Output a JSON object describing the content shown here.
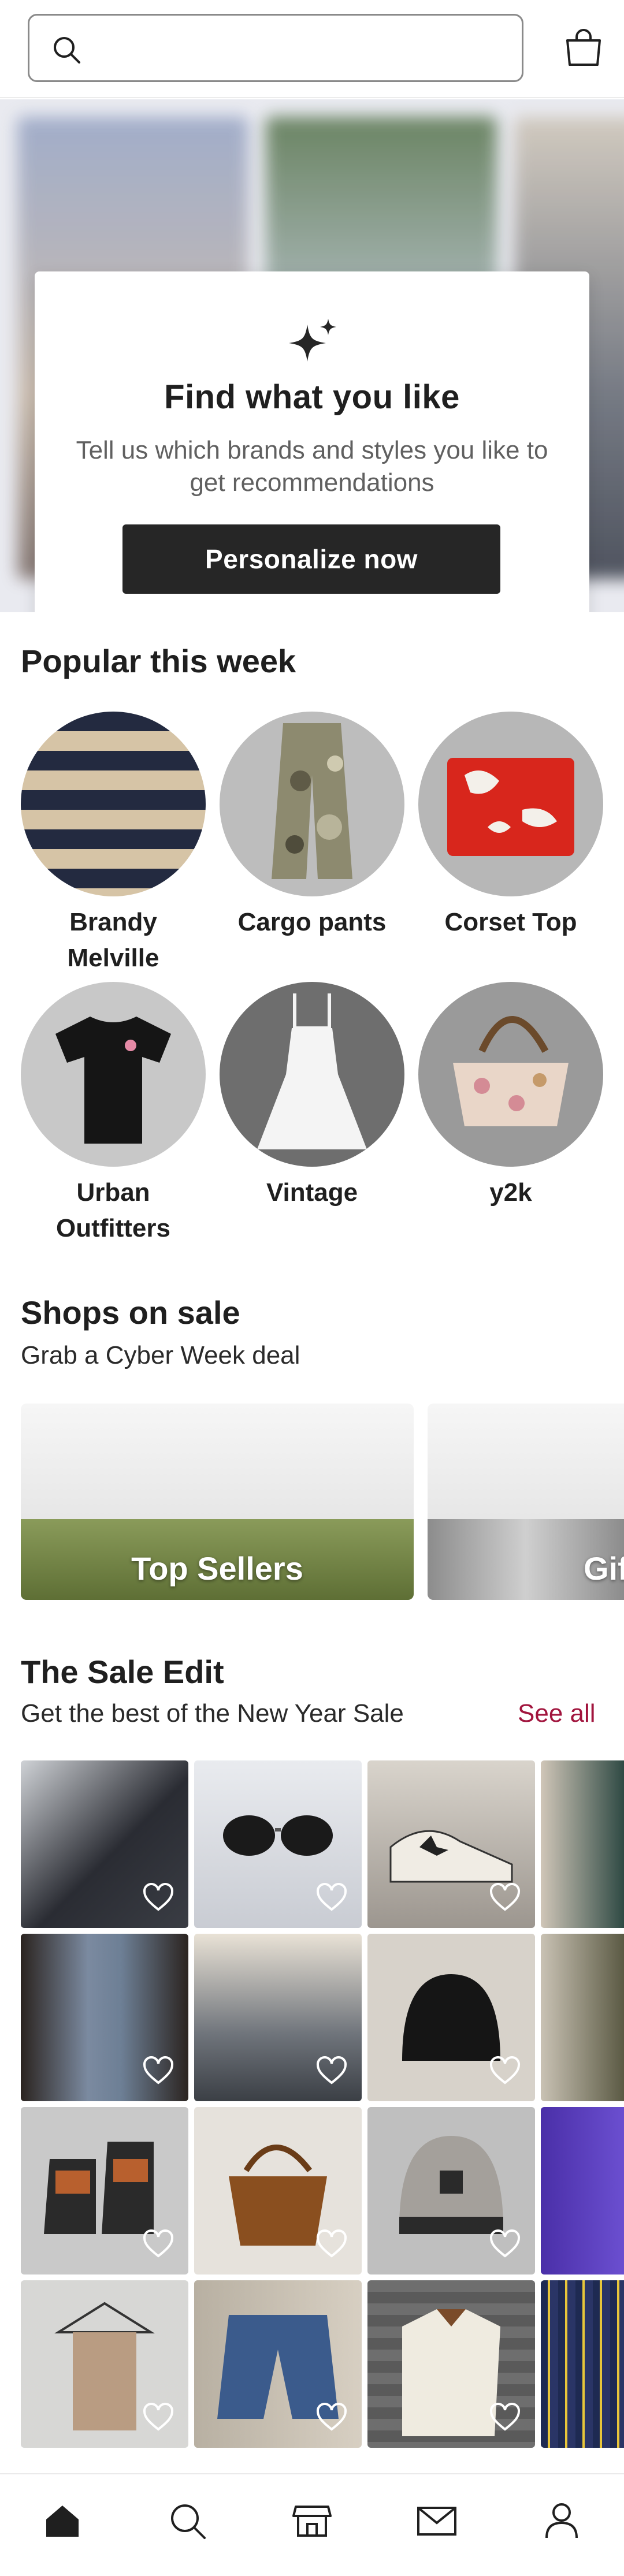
{
  "search": {
    "placeholder": "",
    "icon": "search-icon"
  },
  "header": {
    "bag_icon": "shopping-bag-icon"
  },
  "hero": {
    "title": "Find what you like",
    "description": "Tell us which brands and styles you like to get recommendations",
    "button_label": "Personalize now",
    "icon": "sparkle-icon"
  },
  "popular": {
    "title": "Popular this week",
    "items": [
      {
        "label": "Brandy Melville"
      },
      {
        "label": "Cargo pants"
      },
      {
        "label": "Corset Top"
      },
      {
        "label": "Urban Outfitters"
      },
      {
        "label": "Vintage"
      },
      {
        "label": "y2k"
      }
    ]
  },
  "shops": {
    "title": "Shops on sale",
    "subtitle": "Grab a Cyber Week deal",
    "cards": [
      {
        "label": "Top Sellers"
      },
      {
        "label": "Gifts"
      }
    ]
  },
  "sale_edit": {
    "title": "The Sale Edit",
    "subtitle": "Get the best of the New Year Sale",
    "see_all": "See all",
    "accent_color": "#a1143d"
  },
  "nav": {
    "items": [
      {
        "icon": "home-icon"
      },
      {
        "icon": "search-icon"
      },
      {
        "icon": "shop-icon"
      },
      {
        "icon": "mail-icon"
      },
      {
        "icon": "profile-icon"
      }
    ]
  }
}
